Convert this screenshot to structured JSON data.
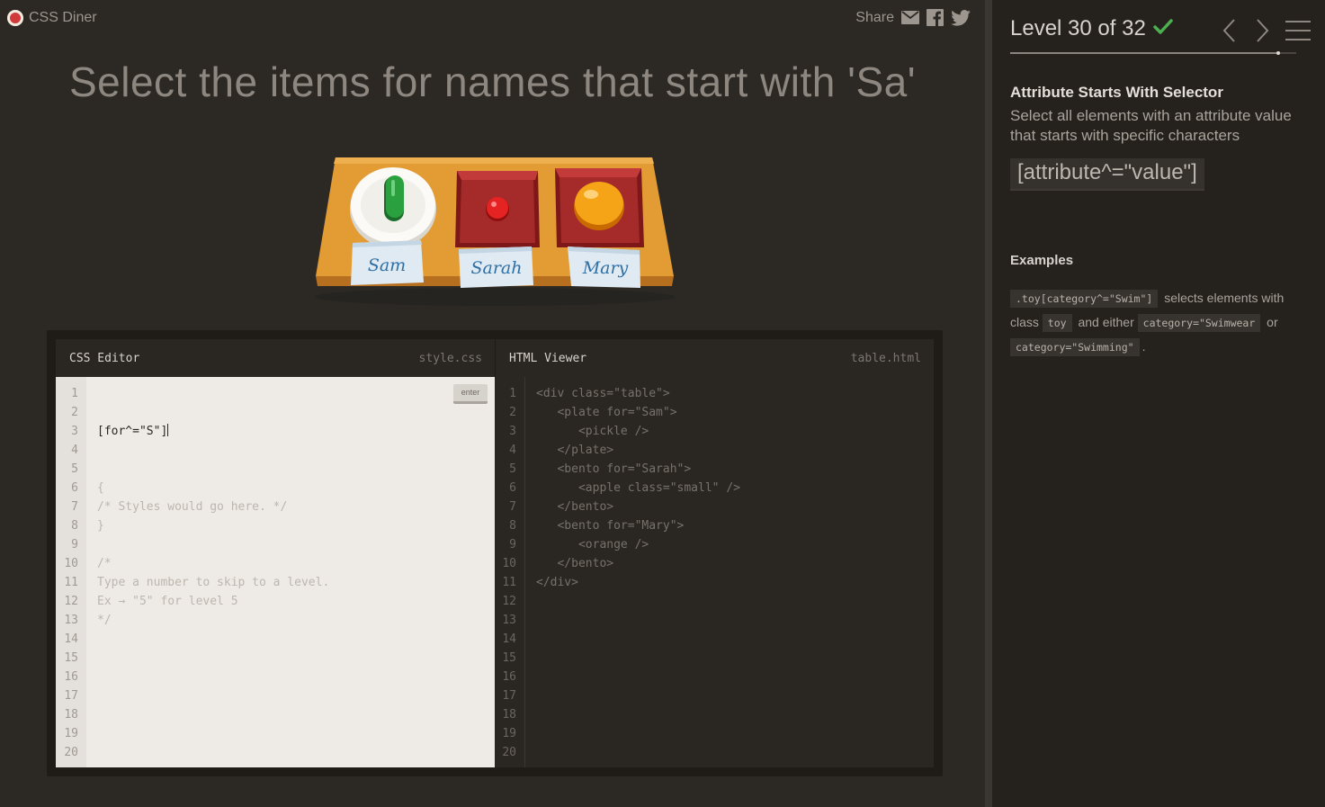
{
  "app": {
    "logo_text": "CSS Diner",
    "share_label": "Share"
  },
  "instruction": "Select the items for names that start with 'Sa'",
  "table": {
    "items": [
      {
        "tag": "plate",
        "for": "Sam",
        "contents": "pickle"
      },
      {
        "tag": "bento",
        "for": "Sarah",
        "contents": "apple.small"
      },
      {
        "tag": "bento",
        "for": "Mary",
        "contents": "orange"
      }
    ]
  },
  "css_editor": {
    "title": "CSS Editor",
    "file": "style.css",
    "enter_label": "enter",
    "input_value": "[for^=\"S\"]",
    "lines": [
      "{",
      "/* Styles would go here. */",
      "}",
      "",
      "/*",
      "Type a number to skip to a level.",
      "Ex → \"5\" for level 5",
      "*/"
    ],
    "line_numbers": [
      "1",
      "2",
      "3",
      "4",
      "5",
      "6",
      "7",
      "8",
      "9",
      "10",
      "11",
      "12",
      "13",
      "14",
      "15",
      "16",
      "17",
      "18",
      "19",
      "20"
    ]
  },
  "html_viewer": {
    "title": "HTML Viewer",
    "file": "table.html",
    "lines": [
      "<div class=\"table\">",
      "   <plate for=\"Sam\">",
      "      <pickle />",
      "   </plate>",
      "   <bento for=\"Sarah\">",
      "      <apple class=\"small\" />",
      "   </bento>",
      "   <bento for=\"Mary\">",
      "      <orange />",
      "   </bento>",
      "</div>"
    ],
    "line_numbers": [
      "1",
      "2",
      "3",
      "4",
      "5",
      "6",
      "7",
      "8",
      "9",
      "10",
      "11",
      "12",
      "13",
      "14",
      "15",
      "16",
      "17",
      "18",
      "19",
      "20"
    ]
  },
  "sidebar": {
    "level_label": "Level 30 of 32",
    "level_current": 30,
    "level_total": 32,
    "completed": true,
    "selector_name": "Attribute Starts With Selector",
    "description": "Select all elements with an attribute value that starts with specific characters",
    "syntax": "[attribute^=\"value\"]",
    "examples_title": "Examples",
    "example": {
      "code1": ".toy[category^=\"Swim\"]",
      "text1": "selects elements with class",
      "code2": "toy",
      "text2": "and either",
      "code3": "category=\"Swimwear",
      "text3": "or",
      "code4": "category=\"Swimming\"",
      "text4": "."
    }
  },
  "colors": {
    "check": "#4cb050",
    "background": "#2c2925",
    "table": "#e39b34"
  }
}
